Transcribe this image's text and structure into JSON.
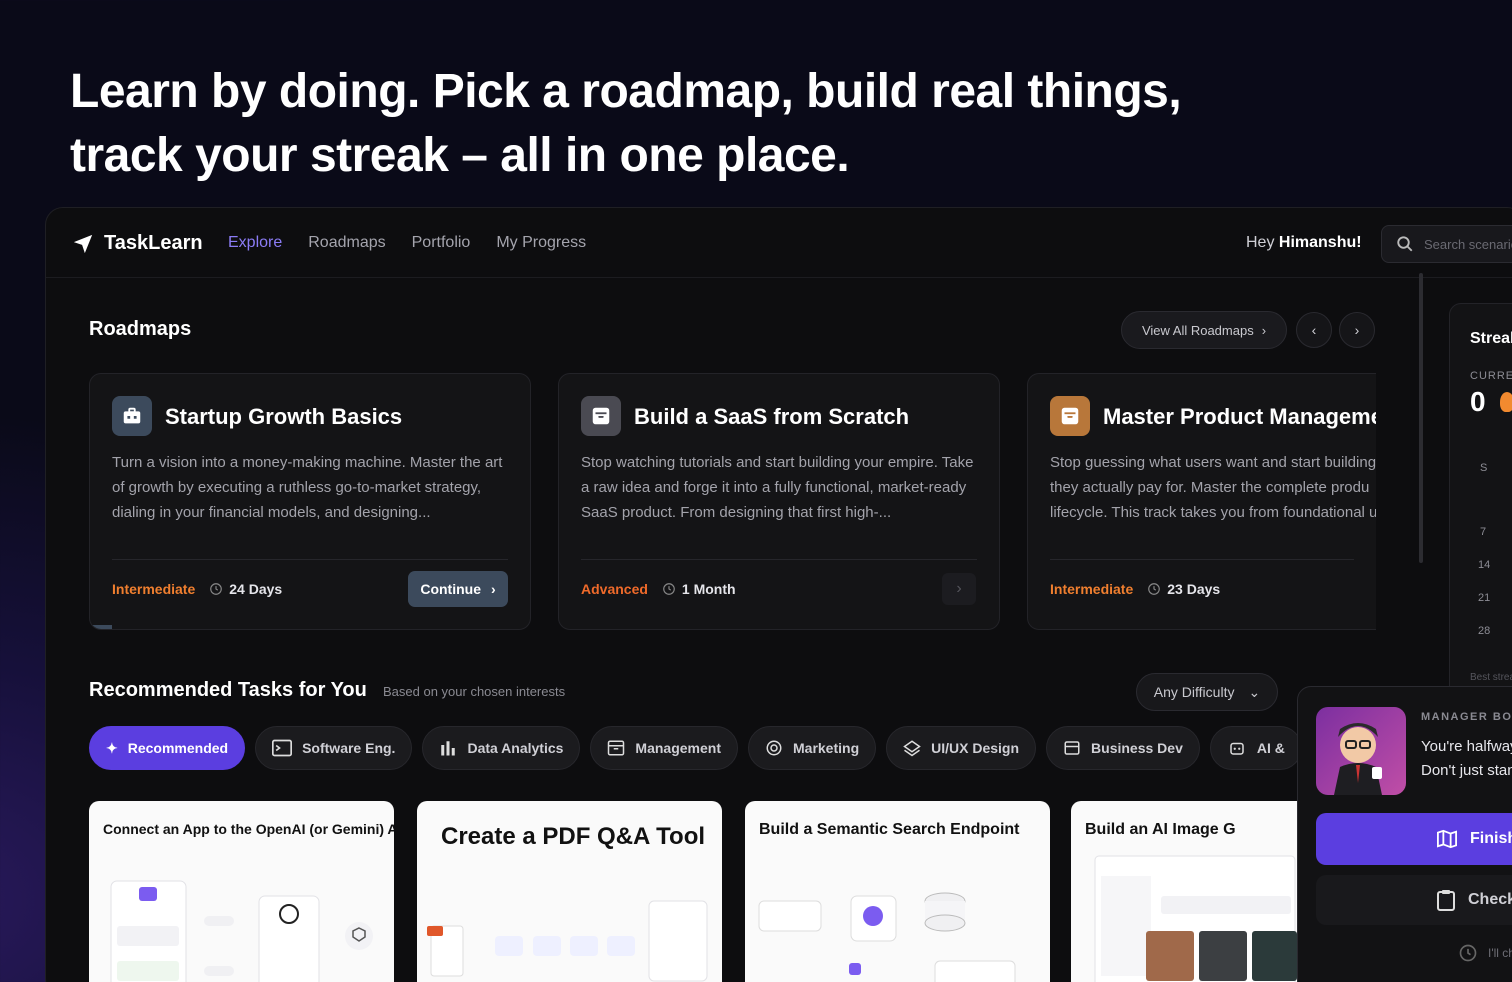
{
  "hero": {
    "line1": "Learn by doing. Pick a roadmap, build real things,",
    "line2": "track your streak – all in one place."
  },
  "nav": {
    "brand": "TaskLearn",
    "links": [
      "Explore",
      "Roadmaps",
      "Portfolio",
      "My Progress"
    ],
    "active_link": "Explore",
    "greeting_prefix": "Hey",
    "user_name": "Himanshu!",
    "search_placeholder": "Search scenario"
  },
  "roadmaps": {
    "title": "Roadmaps",
    "view_all": "View All Roadmaps",
    "cards": [
      {
        "title": "Startup Growth Basics",
        "desc": "Turn a vision into a money-making machine. Master the art of growth by executing a ruthless go-to-market strategy, dialing in your financial models, and designing...",
        "level": "Intermediate",
        "duration": "24 Days",
        "action": "Continue",
        "icon": "briefcase-icon",
        "icon_color": "#3c4a5c"
      },
      {
        "title": "Build a SaaS from Scratch",
        "desc": "Stop watching tutorials and start building your empire. Take a raw idea and forge it into a fully functional, market-ready SaaS product. From designing that first high-...",
        "level": "Advanced",
        "duration": "1 Month",
        "icon": "archive-icon",
        "icon_color": "#4a4a52"
      },
      {
        "title": "Master Product Manageme",
        "desc": "Stop guessing what users want and start building they actually pay for. Master the complete produ lifecycle. This track takes you from foundational u",
        "level": "Intermediate",
        "duration": "23 Days",
        "icon": "archive-icon",
        "icon_color": "#b8773a"
      }
    ]
  },
  "streak": {
    "title": "Streak",
    "current_label": "CURRE",
    "current_value": "0",
    "cal": [
      "S",
      "7",
      "14",
      "21",
      "28"
    ],
    "best": "Best streak"
  },
  "recommended": {
    "title": "Recommended Tasks for You",
    "subtitle": "Based on your chosen interests",
    "difficulty": "Any Difficulty",
    "chips": [
      {
        "label": "Recommended",
        "icon": "sparkle-icon"
      },
      {
        "label": "Software Eng.",
        "icon": "terminal-icon"
      },
      {
        "label": "Data Analytics",
        "icon": "bar-chart-icon"
      },
      {
        "label": "Management",
        "icon": "archive-icon"
      },
      {
        "label": "Marketing",
        "icon": "target-icon"
      },
      {
        "label": "UI/UX Design",
        "icon": "layers-icon"
      },
      {
        "label": "Business Dev",
        "icon": "store-icon"
      },
      {
        "label": "AI &",
        "icon": "robot-icon"
      }
    ],
    "tasks": [
      {
        "title": "Connect an App to the OpenAI (or Gemini) API"
      },
      {
        "title": "Create a PDF Q&A Tool"
      },
      {
        "title": "Build a Semantic Search Endpoint"
      },
      {
        "title": "Build an AI Image G"
      }
    ]
  },
  "manager": {
    "role": "MANAGER BOB",
    "msg1": "You're halfway throu",
    "msg2": "Don't just stand there",
    "finish": "Finish Your I",
    "check": "Check Pend",
    "later": "I'll check it"
  }
}
